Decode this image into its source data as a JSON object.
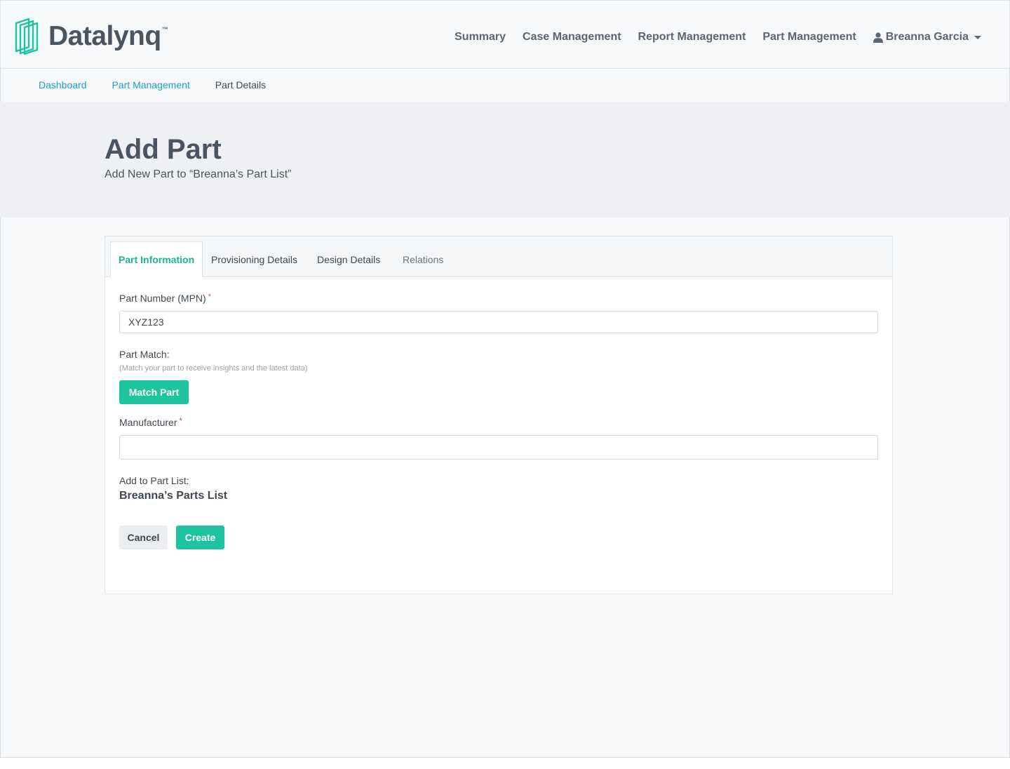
{
  "brand": {
    "name": "Datalynq",
    "trademark": "™"
  },
  "nav": {
    "items": [
      "Summary",
      "Case Management",
      "Report Management",
      "Part Management"
    ],
    "user": "Breanna Garcia"
  },
  "breadcrumb": [
    "Dashboard",
    "Part Management",
    "Part Details"
  ],
  "page": {
    "title": "Add Part",
    "subtitle": "Add New Part to “Breanna’s Part List”"
  },
  "tabs": [
    "Part Information",
    "Provisioning Details",
    "Design Details",
    "Relations"
  ],
  "form": {
    "part_number_label": "Part Number (MPN)",
    "required_mark": "*",
    "part_number_value": "XYZ123",
    "part_match_label": "Part Match:",
    "part_match_hint": "(Match your part to receive insights and the latest data)",
    "match_button": "Match Part",
    "manufacturer_label": "Manufacturer",
    "manufacturer_value": "",
    "add_to_list_label": "Add to Part List:",
    "list_name": "Breanna’s Parts List",
    "cancel_button": "Cancel",
    "create_button": "Create"
  },
  "colors": {
    "accent": "#1ec4a0",
    "link": "#1aa3c4",
    "text": "#4a5561",
    "required": "#e04646"
  },
  "icons": {
    "logo": "datalynq-logo-icon",
    "user": "user-icon",
    "caret": "chevron-down-icon"
  }
}
